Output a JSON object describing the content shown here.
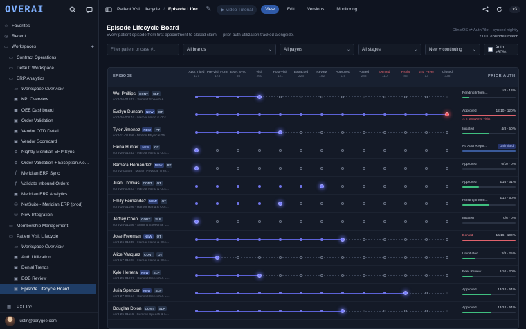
{
  "app": {
    "logo": "OVERAI"
  },
  "sidebar": {
    "items": [
      {
        "label": "Favorites",
        "glyph": "☆",
        "level": 0
      },
      {
        "label": "Recent",
        "glyph": "◷",
        "level": 0
      },
      {
        "label": "Workspaces",
        "glyph": "▭",
        "level": 0,
        "plus": "+"
      },
      {
        "label": "Contract Operations",
        "glyph": "▭",
        "level": 1
      },
      {
        "label": "Default Workspace",
        "glyph": "▭",
        "level": 1
      },
      {
        "label": "ERP Analytics",
        "glyph": "▭",
        "level": 1
      },
      {
        "label": "Workspace Overview",
        "glyph": "▭",
        "level": 2,
        "italic": true
      },
      {
        "label": "KPI Overview",
        "glyph": "▣",
        "level": 2
      },
      {
        "label": "OEE Dashboard",
        "glyph": "▣",
        "level": 2
      },
      {
        "label": "Order Validation",
        "glyph": "▣",
        "level": 2
      },
      {
        "label": "Vendor OTD Detail",
        "glyph": "▣",
        "level": 2
      },
      {
        "label": "Vendor Scorecard",
        "glyph": "▣",
        "level": 2
      },
      {
        "label": "Nightly Meridian ERP Sync",
        "glyph": "⚙",
        "level": 2
      },
      {
        "label": "Order Validation + Exception Ale...",
        "glyph": "⚙",
        "level": 2
      },
      {
        "label": "Meridian ERP Sync",
        "glyph": "ƒ",
        "level": 2
      },
      {
        "label": "Validate Inbound Orders",
        "glyph": "ƒ",
        "level": 2
      },
      {
        "label": "Meridian ERP Analytics",
        "glyph": "▣",
        "level": 2
      },
      {
        "label": "NetSuite - Meridian ERP (prod)",
        "glyph": "⛁",
        "level": 2
      },
      {
        "label": "New Integration",
        "glyph": "⛁",
        "level": 2
      },
      {
        "label": "Membership Management",
        "glyph": "▭",
        "level": 1
      },
      {
        "label": "Patient Visit Lifecycle",
        "glyph": "▭",
        "level": 1
      },
      {
        "label": "Workspace Overview",
        "glyph": "▭",
        "level": 2,
        "italic": true
      },
      {
        "label": "Auth Utilization",
        "glyph": "▣",
        "level": 2
      },
      {
        "label": "Denial Trends",
        "glyph": "▣",
        "level": 2
      },
      {
        "label": "EOB Review",
        "glyph": "▣",
        "level": 2
      },
      {
        "label": "Episode Lifecycle Board",
        "glyph": "▣",
        "level": 2,
        "active": true
      }
    ],
    "org": "PXL Inc.",
    "user_email": "justin@perygee.com"
  },
  "topbar": {
    "crumb_workspace": "Patient Visit Lifecycle",
    "crumb_current": "Episode Lifec...",
    "video_tutorial": "Video Tutorial",
    "tabs": [
      "View",
      "Edit",
      "Versions",
      "Monitoring"
    ],
    "active_tab": "View",
    "version": "v3"
  },
  "header": {
    "title": "Episode Lifecycle Board",
    "subtitle": "Every patient episode from first appointment to closed claim — prior-auth utilization tracked alongside.",
    "meta_line1": "ClinicOS ⇌ AuthPilot · synced nightly",
    "meta_line2": "2,000 episodes match"
  },
  "filters": {
    "search_placeholder": "Filter patient or case #...",
    "brands": "All brands",
    "payers": "All payers",
    "stages": "All stages",
    "status": "New + continuing",
    "auth_label": "Auth ≥80%"
  },
  "board": {
    "episode_header": "EPISODE",
    "prior_auth_header": "PRIOR AUTH",
    "stages": [
      {
        "label": "Appt Inited",
        "count": "137",
        "red": false
      },
      {
        "label": "Pre-Visit Form",
        "count": "173",
        "red": false
      },
      {
        "label": "EMR Sync",
        "count": "85",
        "red": false
      },
      {
        "label": "Visit",
        "count": "260",
        "red": false
      },
      {
        "label": "Post-Visit",
        "count": "121",
        "red": false
      },
      {
        "label": "Extracted",
        "count": "226",
        "red": false
      },
      {
        "label": "Review",
        "count": "152",
        "red": false
      },
      {
        "label": "Approved",
        "count": "119",
        "red": false
      },
      {
        "label": "Posted",
        "count": "283",
        "red": false
      },
      {
        "label": "Denied",
        "count": "110",
        "red": true
      },
      {
        "label": "Rsnbt",
        "count": "86",
        "red": true
      },
      {
        "label": "2nd Payer",
        "count": "13",
        "red": true
      },
      {
        "label": "Closed",
        "count": "338",
        "red": false
      }
    ],
    "rows": [
      {
        "name": "Wei Phillips",
        "tags": [
          "CONT",
          "SLP"
        ],
        "sub": "cont-26-01847 · Summit Speech & L...",
        "progress": 3,
        "red": false,
        "auth_status": "Pending Inform...",
        "auth_count": "1/8 · 13%",
        "auth_pct": 13,
        "auth_color": "#3fbf7f",
        "two_line": true
      },
      {
        "name": "Evelyn Duncan",
        "tags": [
          "NEW",
          "OT"
        ],
        "sub": "cont-26-00174 · Harbor Hand & Occ...",
        "progress": 12,
        "red": true,
        "auth_status": "Approved",
        "auth_count": "12/10 · 120%",
        "auth_pct": 100,
        "auth_color": "#e0626c",
        "note": "2 uncovered visits"
      },
      {
        "name": "Tyler Jimenez",
        "tags": [
          "NEW",
          "PT"
        ],
        "sub": "cont-11-01356 · Motion Physical Th...",
        "progress": 4,
        "red": false,
        "auth_status": "Initiated",
        "auth_count": "4/8 · 50%",
        "auth_pct": 50,
        "auth_color": "#3fbf7f"
      },
      {
        "name": "Elena Hunter",
        "tags": [
          "NEW",
          "OT"
        ],
        "sub": "cont-26-01832 · Harbor Hand & Occ...",
        "progress": 0,
        "red": false,
        "auth_status": "No Auth Requi...",
        "unlimited": "Unlimited",
        "auth_pct": 100,
        "auth_color": "#3a5a9a"
      },
      {
        "name": "Barbara Hernandez",
        "tags": [
          "NEW",
          "PT"
        ],
        "sub": "cont-2-00466 · Motion Physical Ther...",
        "progress": 0,
        "red": false,
        "auth_status": "Approved",
        "auth_count": "0/10 · 0%",
        "auth_pct": 0,
        "auth_color": "#3fbf7f"
      },
      {
        "name": "Juan Thomas",
        "tags": [
          "CONT",
          "OT"
        ],
        "sub": "cont-26-00323 · Harbor Hand & Occ...",
        "progress": 6,
        "red": false,
        "auth_status": "Approved",
        "auth_count": "5/16 · 31%",
        "auth_pct": 31,
        "auth_color": "#3fbf7f"
      },
      {
        "name": "Emily Fernandez",
        "tags": [
          "NEW",
          "OT"
        ],
        "sub": "cont-16-01196 · Harbor Hand & Occ...",
        "progress": 4,
        "red": false,
        "auth_status": "Pending Inform...",
        "auth_count": "6/12 · 50%",
        "auth_pct": 50,
        "auth_color": "#3fbf7f",
        "two_line": true
      },
      {
        "name": "Jeffrey Chen",
        "tags": [
          "CONT",
          "SLP"
        ],
        "sub": "cont-25-01186 · Summit Speech & L...",
        "progress": 0,
        "red": false,
        "auth_status": "Initiated",
        "auth_count": "0/6 · 0%",
        "auth_pct": 0,
        "auth_color": "#3fbf7f"
      },
      {
        "name": "Jose Freeman",
        "tags": [
          "NEW",
          "OT"
        ],
        "sub": "cont-26-01335 · Harbor Hand & Occ...",
        "progress": 7,
        "red": false,
        "auth_status": "Denied",
        "auth_count": "16/16 · 100%",
        "auth_pct": 100,
        "auth_color": "#e0626c",
        "status_red": true
      },
      {
        "name": "Alice Vasquez",
        "tags": [
          "CONT",
          "OT"
        ],
        "sub": "cont-17-01828 · Harbor Hand & Occ...",
        "progress": 1,
        "red": false,
        "auth_status": "Uninitiated",
        "auth_count": "2/8 · 25%",
        "auth_pct": 25,
        "auth_color": "#3fbf7f"
      },
      {
        "name": "Kyle Herrera",
        "tags": [
          "NEW",
          "SLP"
        ],
        "sub": "cont-25-01997 · Summit Speech & L...",
        "progress": 3,
        "red": false,
        "auth_status": "Peer Review",
        "auth_count": "2/10 · 20%",
        "auth_pct": 20,
        "auth_color": "#3fbf7f"
      },
      {
        "name": "Julia Spencer",
        "tags": [
          "NEW",
          "SLP"
        ],
        "sub": "cont-27-00654 · Summit Speech & L...",
        "progress": 10,
        "red": false,
        "auth_status": "Approved",
        "auth_count": "13/24 · 54%",
        "auth_pct": 54,
        "auth_color": "#3fbf7f"
      },
      {
        "name": "Douglas Dixon",
        "tags": [
          "CONT",
          "SLP"
        ],
        "sub": "cont-25-01116 · Summit Speech & L...",
        "progress": 7,
        "red": false,
        "auth_status": "Approved",
        "auth_count": "13/24 · 54%",
        "auth_pct": 54,
        "auth_color": "#3fbf7f"
      }
    ]
  },
  "colors": {
    "accent": "#6f74e8",
    "danger": "#e0626c",
    "ok": "#3fbf7f",
    "active_nav": "#1f3d66"
  }
}
